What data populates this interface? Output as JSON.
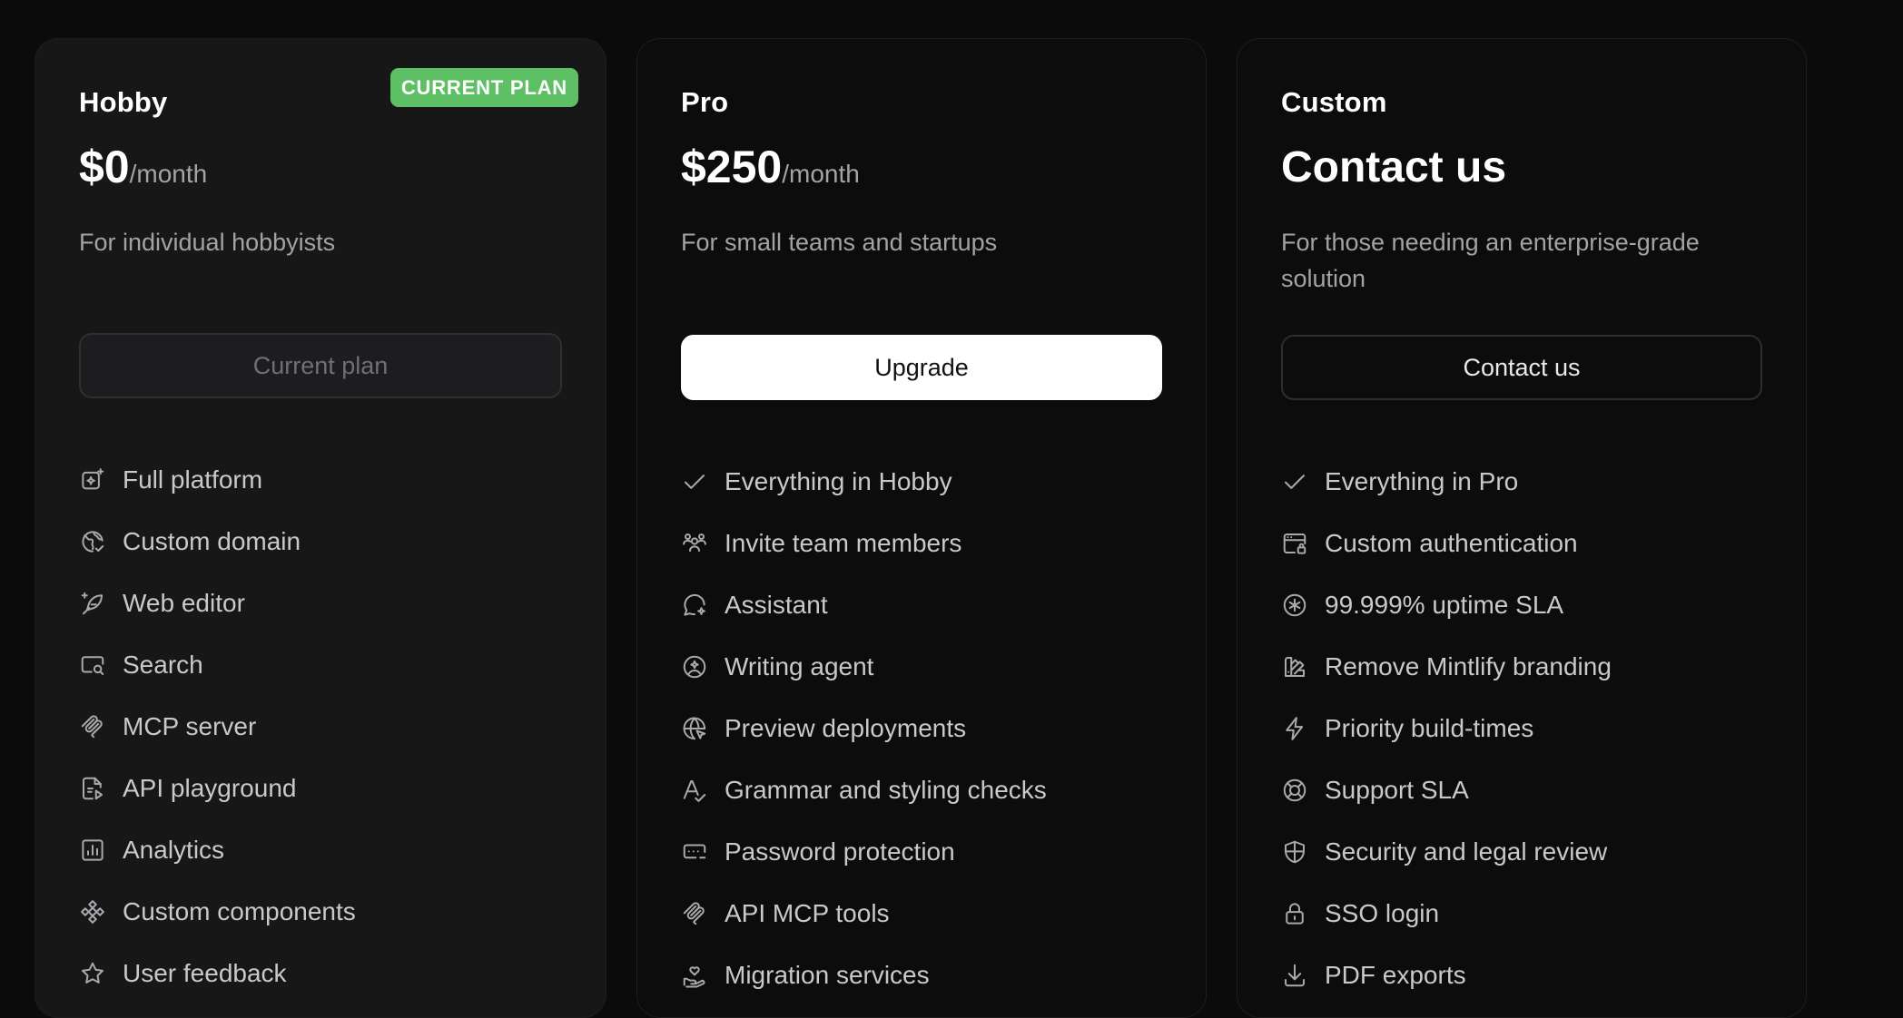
{
  "plans": {
    "hobby": {
      "name": "Hobby",
      "badge": "CURRENT PLAN",
      "price": "$0",
      "period": "/month",
      "description": "For individual hobbyists",
      "button_label": "Current plan",
      "features": [
        {
          "label": "Full platform",
          "icon": "sparkle-square-icon"
        },
        {
          "label": "Custom domain",
          "icon": "globe-check-icon"
        },
        {
          "label": "Web editor",
          "icon": "feather-pen-icon"
        },
        {
          "label": "Search",
          "icon": "search-window-icon"
        },
        {
          "label": "MCP server",
          "icon": "mcp-icon"
        },
        {
          "label": "API playground",
          "icon": "file-play-icon"
        },
        {
          "label": "Analytics",
          "icon": "bar-chart-icon"
        },
        {
          "label": "Custom components",
          "icon": "components-icon"
        },
        {
          "label": "User feedback",
          "icon": "star-icon"
        }
      ]
    },
    "pro": {
      "name": "Pro",
      "price": "$250",
      "period": "/month",
      "description": "For small teams and startups",
      "button_label": "Upgrade",
      "features": [
        {
          "label": "Everything in Hobby",
          "icon": "check-icon"
        },
        {
          "label": "Invite team members",
          "icon": "users-icon"
        },
        {
          "label": "Assistant",
          "icon": "chat-sparkle-icon"
        },
        {
          "label": "Writing agent",
          "icon": "agent-icon"
        },
        {
          "label": "Preview deployments",
          "icon": "globe-cursor-icon"
        },
        {
          "label": "Grammar and styling checks",
          "icon": "text-check-icon"
        },
        {
          "label": "Password protection",
          "icon": "password-icon"
        },
        {
          "label": "API MCP tools",
          "icon": "mcp-icon"
        },
        {
          "label": "Migration services",
          "icon": "hand-heart-icon"
        }
      ]
    },
    "custom": {
      "name": "Custom",
      "headline": "Contact us",
      "description": "For those needing an enterprise-grade solution",
      "button_label": "Contact us",
      "features": [
        {
          "label": "Everything in Pro",
          "icon": "check-icon"
        },
        {
          "label": "Custom authentication",
          "icon": "auth-window-icon"
        },
        {
          "label": "99.999% uptime SLA",
          "icon": "asterisk-circle-icon"
        },
        {
          "label": "Remove Mintlify branding",
          "icon": "paint-roller-icon"
        },
        {
          "label": "Priority build-times",
          "icon": "lightning-icon"
        },
        {
          "label": "Support SLA",
          "icon": "lifebuoy-icon"
        },
        {
          "label": "Security and legal review",
          "icon": "shield-icon"
        },
        {
          "label": "SSO login",
          "icon": "lock-icon"
        },
        {
          "label": "PDF exports",
          "icon": "download-icon"
        }
      ]
    }
  },
  "colors": {
    "badge_green": "#5ec064",
    "page_background": "#0b0b0c",
    "hobby_card": "#171718"
  }
}
